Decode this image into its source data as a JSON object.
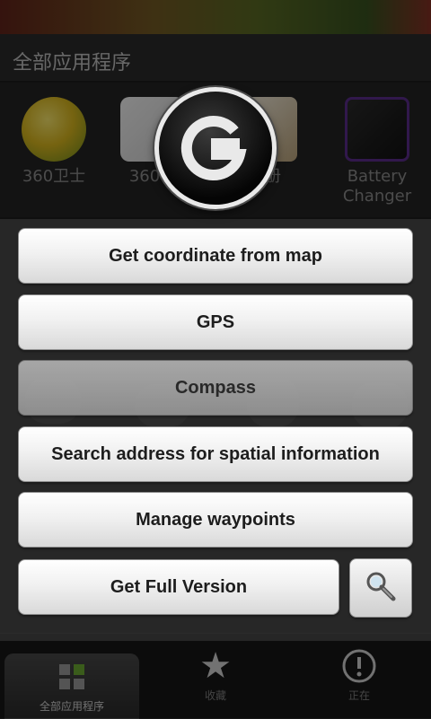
{
  "launcher": {
    "title": "全部应用程序",
    "apps": [
      {
        "label": "360卫士"
      },
      {
        "label": "360手"
      },
      {
        "label": "相册"
      },
      {
        "label": "Battery\nChanger"
      }
    ],
    "nav": [
      {
        "label": "全部应用程序"
      },
      {
        "label": "收藏"
      },
      {
        "label": "正在"
      }
    ]
  },
  "dialog": {
    "logo_letter": "G",
    "buttons": {
      "coord": "Get coordinate from map",
      "gps": "GPS",
      "compass": "Compass",
      "search": "Search address for spatial information",
      "waypoints": "Manage waypoints",
      "full": "Get Full Version"
    }
  },
  "colors": {
    "button_text": "#1d1d1d",
    "background": "#1c1c1c"
  }
}
